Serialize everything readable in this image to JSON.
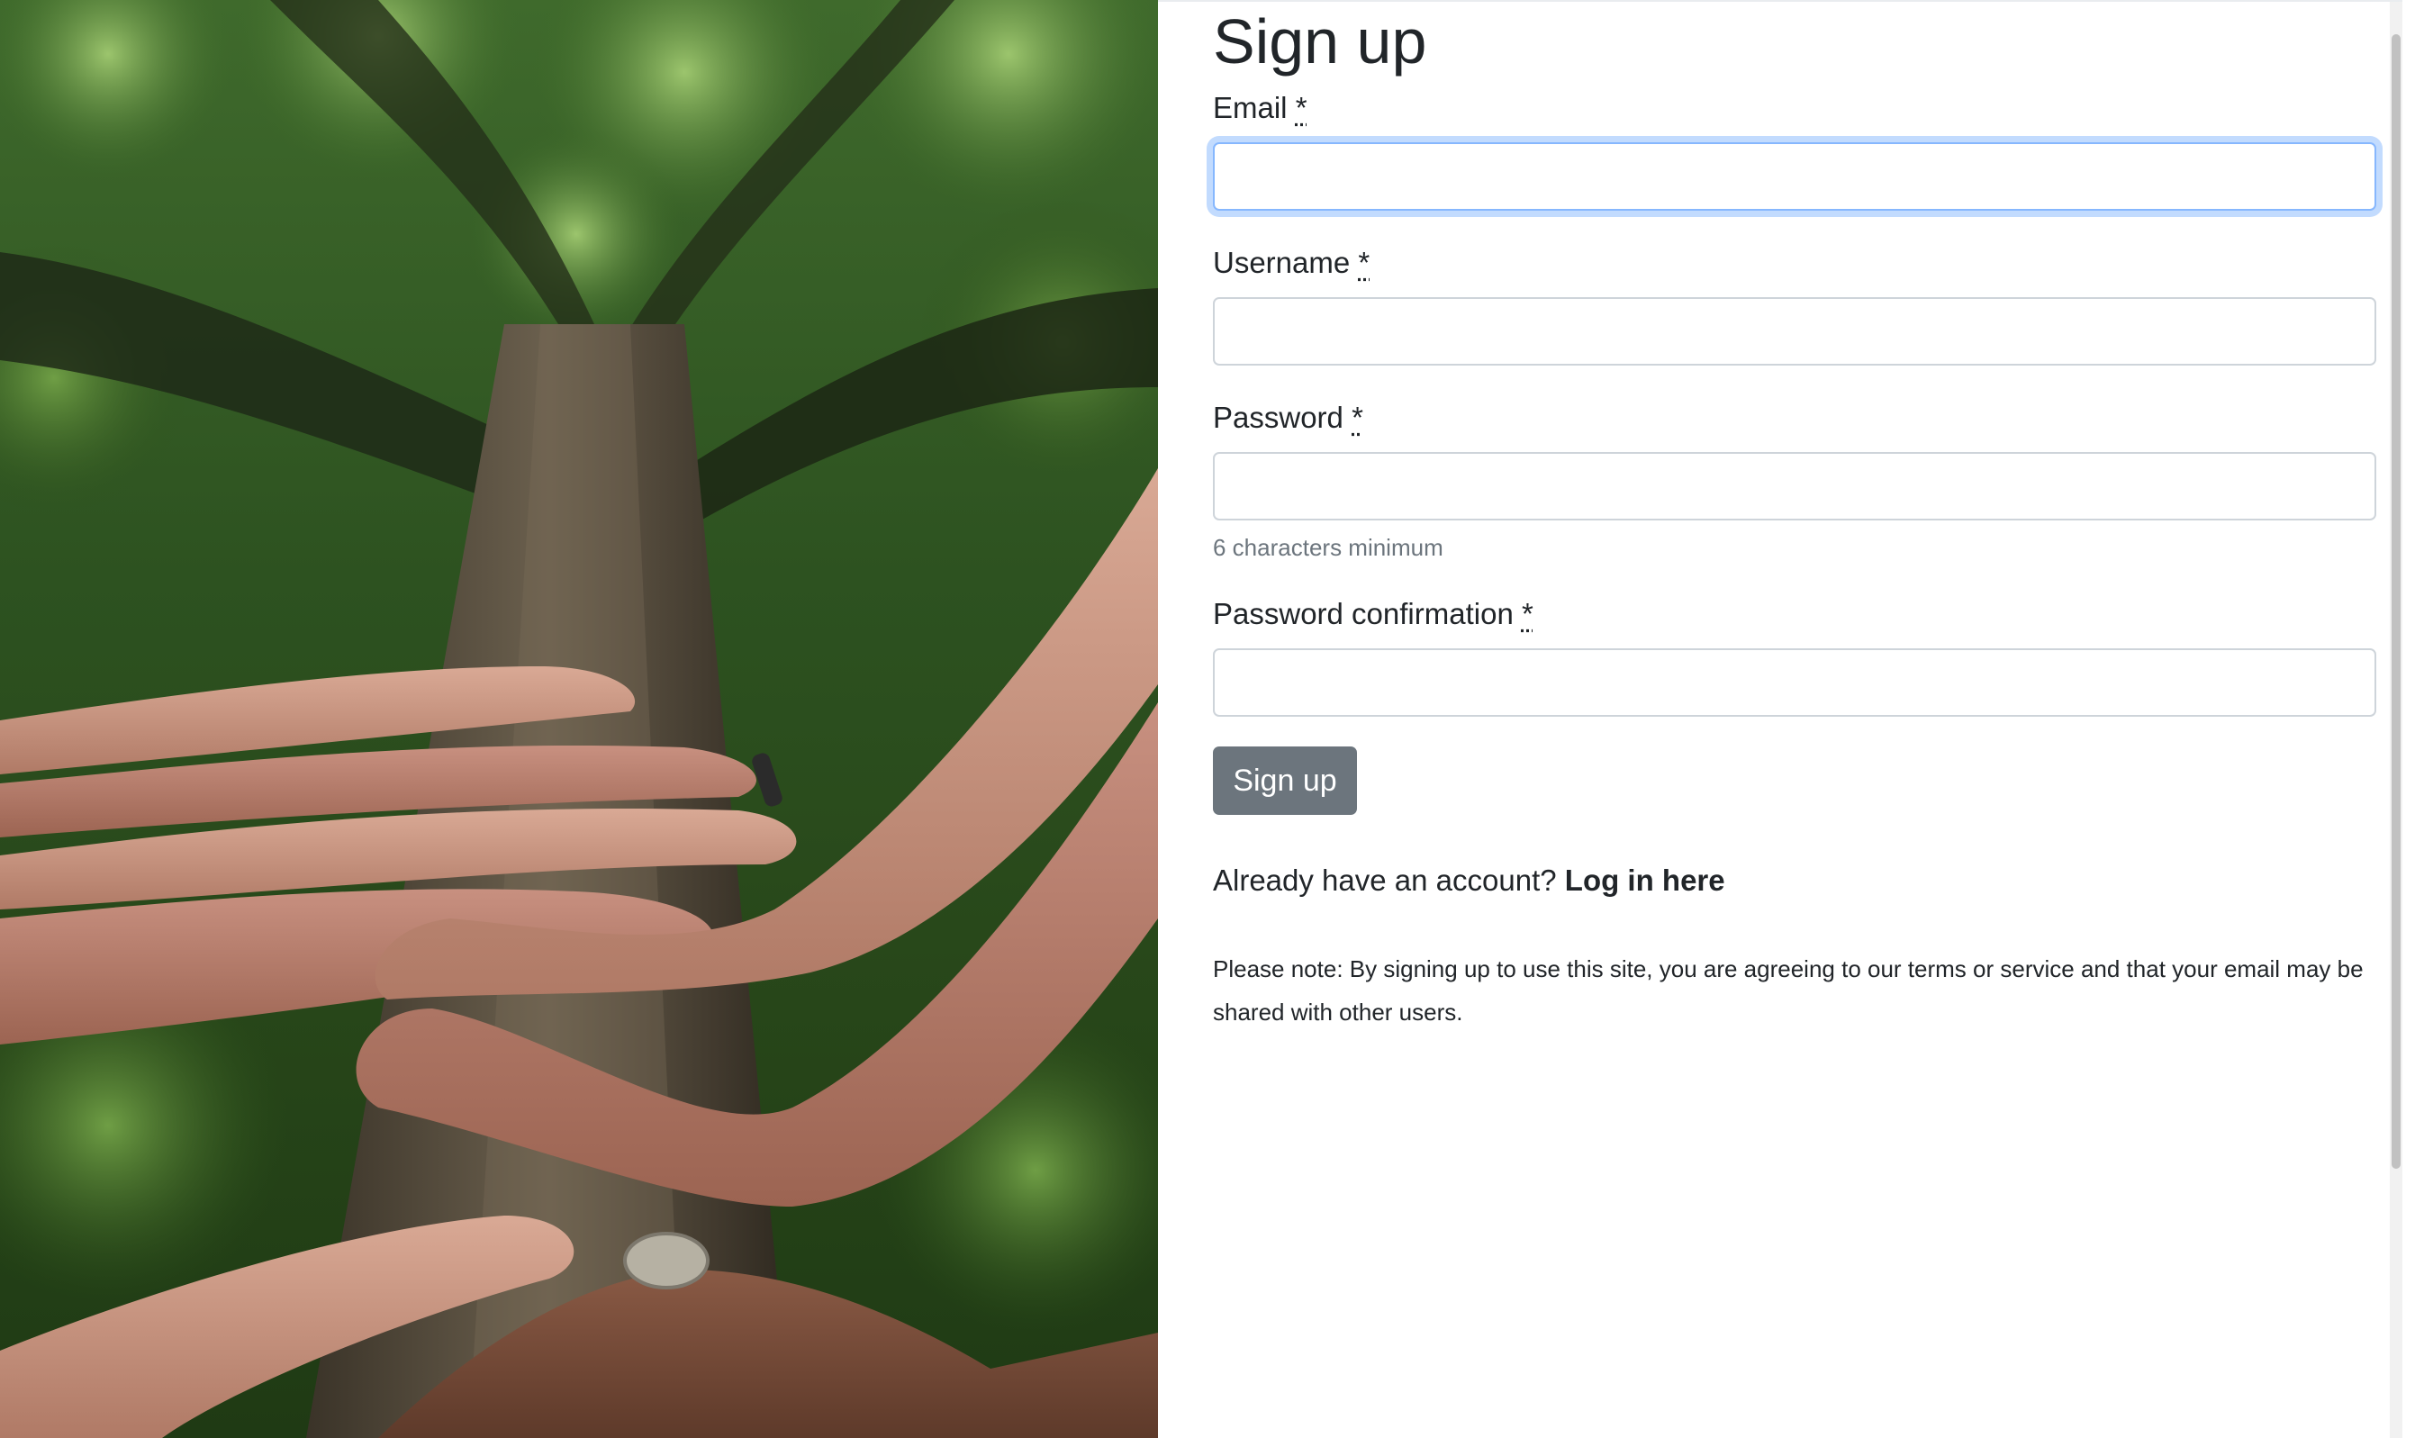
{
  "photo": {
    "alt": "Hands resting on a tree trunk in a forest"
  },
  "form": {
    "title": "Sign up",
    "required_marker": "*",
    "fields": [
      {
        "label": "Email",
        "value": "",
        "placeholder": ""
      },
      {
        "label": "Username",
        "value": "",
        "placeholder": ""
      },
      {
        "label": "Password",
        "value": "",
        "placeholder": "",
        "help": "6 characters minimum"
      },
      {
        "label": "Password confirmation",
        "value": "",
        "placeholder": ""
      }
    ],
    "submit_label": "Sign up",
    "login_prompt": "Already have an account?",
    "login_link": "Log in here",
    "note": "Please note: By signing up to use this site, you are agreeing to our terms or service and that your email may be shared with other users."
  },
  "colors": {
    "button_bg": "#6c757d",
    "focus_ring": "#86b7fe",
    "help_text": "#6c757d"
  }
}
